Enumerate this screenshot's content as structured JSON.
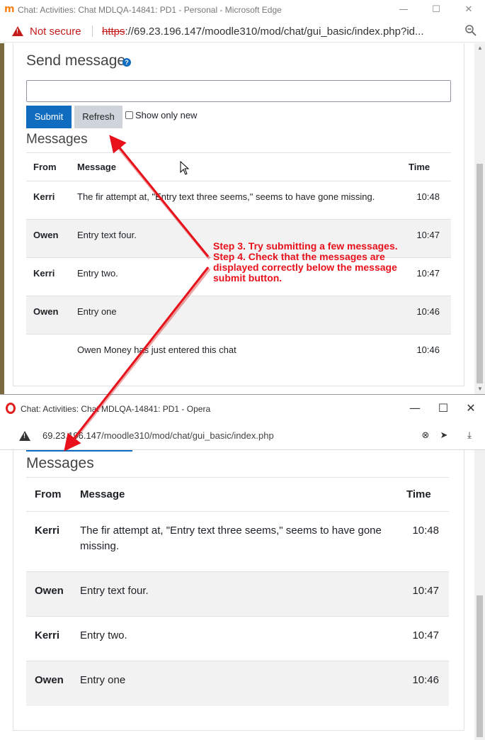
{
  "edge": {
    "window_title": "Chat: Activities: Chat MDLQA-14841: PD1 - Personal - Microsoft Edge",
    "not_secure": "Not secure",
    "url_scheme": "https",
    "url_rest": "://69.23.196.147/moodle310/mod/chat/gui_basic/index.php?id...",
    "send_heading": "Send message",
    "message_value": "",
    "submit_label": "Submit",
    "refresh_label": "Refresh",
    "show_only_new_label": "Show only new",
    "messages_heading": "Messages",
    "columns": {
      "from": "From",
      "message": "Message",
      "time": "Time"
    },
    "rows": [
      {
        "from": "Kerri",
        "message": "The fir attempt at, \"Entry text three seems,\" seems to have gone missing.",
        "time": "10:48"
      },
      {
        "from": "Owen",
        "message": "Entry text four.",
        "time": "10:47"
      },
      {
        "from": "Kerri",
        "message": "Entry two.",
        "time": "10:47"
      },
      {
        "from": "Owen",
        "message": "Entry one",
        "time": "10:46"
      },
      {
        "from": "",
        "message": "Owen Money has just entered this chat",
        "time": "10:46"
      }
    ]
  },
  "opera": {
    "window_title": "Chat: Activities: Chat MDLQA-14841: PD1 - Opera",
    "url_host": "69.23.196.147",
    "url_path": "/moodle310/mod/chat/gui_basic/index.php",
    "messages_heading": "Messages",
    "columns": {
      "from": "From",
      "message": "Message",
      "time": "Time"
    },
    "rows": [
      {
        "from": "Kerri",
        "message": "The fir attempt at, \"Entry text three seems,\" seems to have gone missing.",
        "time": "10:48"
      },
      {
        "from": "Owen",
        "message": "Entry text four.",
        "time": "10:47"
      },
      {
        "from": "Kerri",
        "message": "Entry two.",
        "time": "10:47"
      },
      {
        "from": "Owen",
        "message": "Entry one",
        "time": "10:46"
      }
    ]
  },
  "annotation": {
    "step3": "Step 3. Try submitting a few messages.",
    "step4": "Step 4. Check that the messages are displayed correctly below the message submit button.",
    "color": "#e8101a"
  },
  "colors": {
    "primary": "#0f6cbf",
    "secondary_btn": "#ced4da",
    "stripe": "#f2f2f2",
    "not_secure": "#c41b1b"
  }
}
